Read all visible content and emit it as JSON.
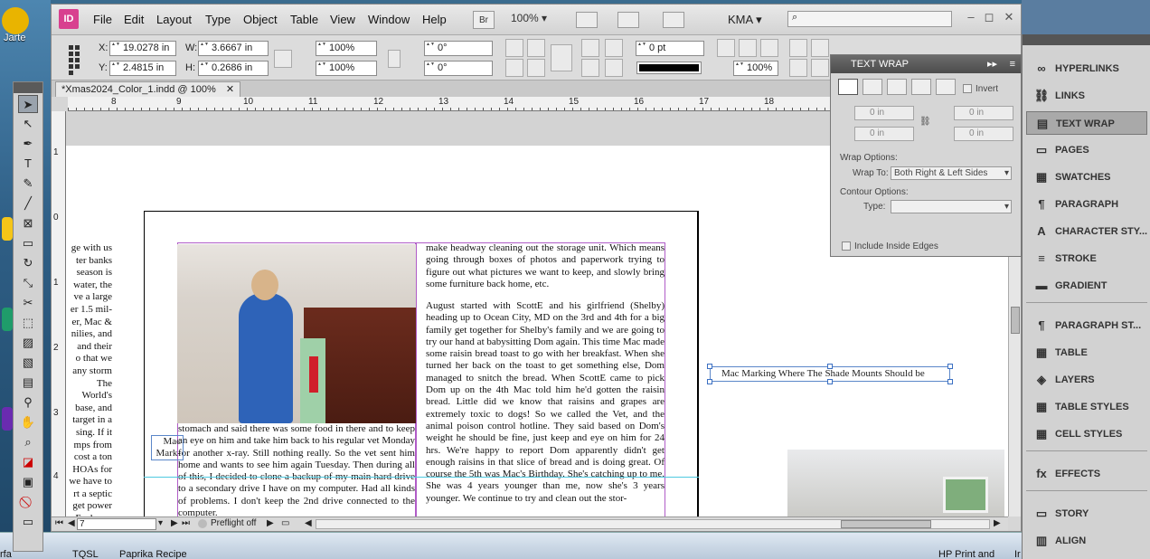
{
  "desktop": {
    "left_icon_label": "Jarte"
  },
  "taskbar": {
    "items": [
      "TQSL",
      "Paprika Recipe",
      "HP Print and",
      "Ir",
      "rfa"
    ]
  },
  "app": {
    "logo": "ID",
    "menu": [
      "File",
      "Edit",
      "Layout",
      "Type",
      "Object",
      "Table",
      "View",
      "Window",
      "Help"
    ],
    "bridge_button": "Br",
    "zoom": "100%",
    "workspace": "KMA",
    "window_controls": [
      "–",
      "◻",
      "✕"
    ]
  },
  "control_panel": {
    "x_label": "X:",
    "x_value": "19.0278 in",
    "y_label": "Y:",
    "y_value": "2.4815 in",
    "w_label": "W:",
    "w_value": "3.6667 in",
    "h_label": "H:",
    "h_value": "0.2686 in",
    "scale_x": "100%",
    "scale_y": "100%",
    "rotate": "0°",
    "shear": "0°",
    "stroke_weight": "0 pt",
    "opacity": "100%"
  },
  "document": {
    "tab_title": "*Xmas2024_Color_1.indd @ 100%",
    "tab_close": "✕",
    "ruler_numbers": [
      "8",
      "9",
      "10",
      "11",
      "12",
      "13",
      "14",
      "15",
      "16",
      "17",
      "18"
    ],
    "vruler_numbers": [
      "1",
      "0",
      "1",
      "2",
      "3",
      "4"
    ],
    "left_column": "ge with us\nter banks\nseason is\nwater, the\nve a large\ner 1.5 mil-\ner, Mac &\nnilies, and\nand their\no that we\nany storm\nThe World's\nbase, and\ntarget in a\nsing. If it\nmps from\ncost a ton\nHOAs for\nwe have to\nrt a septic\nget power\nEach one\neral thou-",
    "middle_text": "stomach and said there was some food in there and to keep an eye on him and take him back to his regular vet Monday for another x-ray. Still nothing really. So the vet sent him home and wants to see him again Tuesday. Then during all of this, I decided to clone a backup of my main hard drive to a secondary drive I have on my computer. Had all kinds of problems. I don't keep the 2nd drive connected to the computer.",
    "right_text_1": "make headway cleaning out the storage unit. Which means going through boxes of photos and paperwork trying to figure out what pictures we want to keep, and slowly bring some furniture back home, etc.",
    "right_text_2": "August started with ScottE and his girlfriend (Shelby) heading up to Ocean City, MD on the 3rd and 4th for a big family get together for Shelby's family and we are going to try our hand at babysitting Dom again. This time Mac made some raisin bread toast to go with her breakfast. When she turned her back on the toast to get something else, Dom managed to snitch the bread. When ScottE came to pick Dom up on the 4th Mac told him he'd gotten the raisin bread. Little did we know that raisins and grapes are extremely toxic to dogs! So we called the Vet, and the animal poison control hotline. They said based on Dom's weight he should be fine, just keep and eye on him for 24 hrs. We're happy to report Dom apparently didn't get enough raisins in that slice of bread and is doing great. Of course the 5th was Mac's Birthday. She's catching up to me. She was 4 years younger than me, now she's 3 years younger. We continue to try and clean out the stor-",
    "caption": "Mac\nMark-",
    "floating_label": "Mac Marking Where The Shade Mounts Should be",
    "page_number": "7",
    "preflight": "Preflight off"
  },
  "text_wrap_panel": {
    "title": "TEXT WRAP",
    "invert": "Invert",
    "offset_top": "0 in",
    "offset_left": "0 in",
    "offset_bottom": "0 in",
    "offset_right": "0 in",
    "wrap_options_label": "Wrap Options:",
    "wrap_to_label": "Wrap To:",
    "wrap_to_value": "Both Right & Left Sides",
    "contour_options_label": "Contour Options:",
    "type_label": "Type:",
    "type_value": "",
    "include_inside_edges": "Include Inside Edges"
  },
  "panels": [
    {
      "label": "HYPERLINKS",
      "icon": "hyperlinks-icon",
      "glyph": "∞"
    },
    {
      "label": "LINKS",
      "icon": "links-icon",
      "glyph": "⛓"
    },
    {
      "label": "TEXT WRAP",
      "icon": "text-wrap-icon",
      "glyph": "▤"
    },
    {
      "label": "PAGES",
      "icon": "pages-icon",
      "glyph": "▭"
    },
    {
      "label": "SWATCHES",
      "icon": "swatches-icon",
      "glyph": "▦"
    },
    {
      "label": "PARAGRAPH",
      "icon": "paragraph-icon",
      "glyph": "¶"
    },
    {
      "label": "CHARACTER STY...",
      "icon": "character-styles-icon",
      "glyph": "A"
    },
    {
      "label": "STROKE",
      "icon": "stroke-icon",
      "glyph": "≡"
    },
    {
      "label": "GRADIENT",
      "icon": "gradient-icon",
      "glyph": "▬"
    },
    {
      "label": "PARAGRAPH ST...",
      "icon": "paragraph-styles-icon",
      "glyph": "¶"
    },
    {
      "label": "TABLE",
      "icon": "table-icon",
      "glyph": "▦"
    },
    {
      "label": "LAYERS",
      "icon": "layers-icon",
      "glyph": "◈"
    },
    {
      "label": "TABLE STYLES",
      "icon": "table-styles-icon",
      "glyph": "▦"
    },
    {
      "label": "CELL STYLES",
      "icon": "cell-styles-icon",
      "glyph": "▦"
    },
    {
      "label": "EFFECTS",
      "icon": "effects-icon",
      "glyph": "fx"
    },
    {
      "label": "STORY",
      "icon": "story-icon",
      "glyph": "▭"
    },
    {
      "label": "ALIGN",
      "icon": "align-icon",
      "glyph": "▥"
    }
  ]
}
